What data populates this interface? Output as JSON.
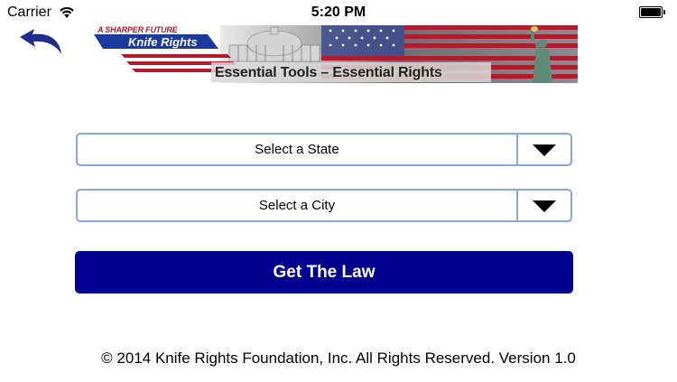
{
  "status_bar": {
    "carrier": "Carrier",
    "time": "5:20 PM"
  },
  "icons": {
    "back": "back-arrow-icon",
    "wifi": "wifi-icon",
    "battery": "battery-icon",
    "dropdown": "triangle-down-icon"
  },
  "banner": {
    "tagline": "A SHARPER FUTURE",
    "logo": "Knife Rights",
    "slogan": "Essential Tools – Essential Rights"
  },
  "form": {
    "state_select": {
      "selected": "Select a State"
    },
    "city_select": {
      "selected": "Select a City"
    },
    "submit_label": "Get The Law"
  },
  "footer": {
    "copyright": "© 2014 Knife Rights Foundation, Inc. All Rights Reserved. Version 1.0"
  },
  "colors": {
    "button_bg": "#00008f",
    "dropdown_border": "#8aa6dd",
    "back_arrow": "#1f2c8c",
    "flag_red": "#b01c2e",
    "flag_blue": "#3b4a8c"
  }
}
